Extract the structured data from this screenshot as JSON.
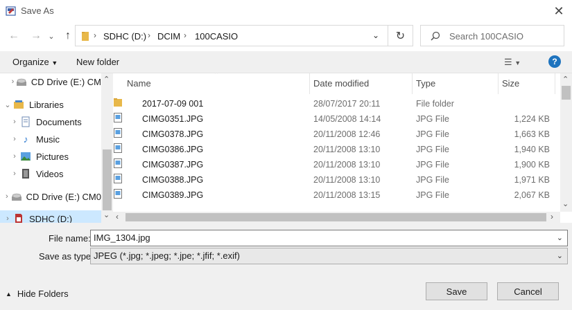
{
  "window": {
    "title": "Save As"
  },
  "nav": {
    "breadcrumb": [
      "SDHC (D:)",
      "DCIM",
      "100CASIO"
    ],
    "search_placeholder": "Search 100CASIO"
  },
  "toolbar": {
    "organize_label": "Organize",
    "new_folder_label": "New folder"
  },
  "navpane": {
    "items": [
      {
        "label": "CD Drive (E:) CM",
        "icon": "cd-drive-icon"
      },
      {
        "label": "Libraries",
        "icon": "libraries-icon"
      },
      {
        "label": "Documents",
        "icon": "documents-icon"
      },
      {
        "label": "Music",
        "icon": "music-icon"
      },
      {
        "label": "Pictures",
        "icon": "pictures-icon"
      },
      {
        "label": "Videos",
        "icon": "videos-icon"
      },
      {
        "label": "CD Drive (E:) CM0",
        "icon": "cd-drive-icon"
      },
      {
        "label": "SDHC (D:)",
        "icon": "sd-card-icon"
      }
    ]
  },
  "filelist": {
    "columns": {
      "name": "Name",
      "date": "Date modified",
      "type": "Type",
      "size": "Size"
    },
    "rows": [
      {
        "name": "2017-07-09 001",
        "date": "28/07/2017 20:11",
        "type": "File folder",
        "size": "",
        "icon": "folder-icon"
      },
      {
        "name": "CIMG0351.JPG",
        "date": "14/05/2008 14:14",
        "type": "JPG File",
        "size": "1,224 KB",
        "icon": "image-file-icon"
      },
      {
        "name": "CIMG0378.JPG",
        "date": "20/11/2008 12:46",
        "type": "JPG File",
        "size": "1,663 KB",
        "icon": "image-file-icon"
      },
      {
        "name": "CIMG0386.JPG",
        "date": "20/11/2008 13:10",
        "type": "JPG File",
        "size": "1,940 KB",
        "icon": "image-file-icon"
      },
      {
        "name": "CIMG0387.JPG",
        "date": "20/11/2008 13:10",
        "type": "JPG File",
        "size": "1,900 KB",
        "icon": "image-file-icon"
      },
      {
        "name": "CIMG0388.JPG",
        "date": "20/11/2008 13:10",
        "type": "JPG File",
        "size": "1,971 KB",
        "icon": "image-file-icon"
      },
      {
        "name": "CIMG0389.JPG",
        "date": "20/11/2008 13:15",
        "type": "JPG File",
        "size": "2,067 KB",
        "icon": "image-file-icon"
      }
    ]
  },
  "form": {
    "file_name_label": "File name:",
    "file_name_value": "IMG_1304.jpg",
    "save_type_label": "Save as type:",
    "save_type_value": "JPEG (*.jpg; *.jpeg; *.jpe; *.jfif; *.exif)"
  },
  "footer": {
    "hide_folders_label": "Hide Folders",
    "save_label": "Save",
    "cancel_label": "Cancel"
  },
  "colors": {
    "accent": "#1e73be",
    "folder": "#e8b84a",
    "selection": "#cce8ff"
  }
}
